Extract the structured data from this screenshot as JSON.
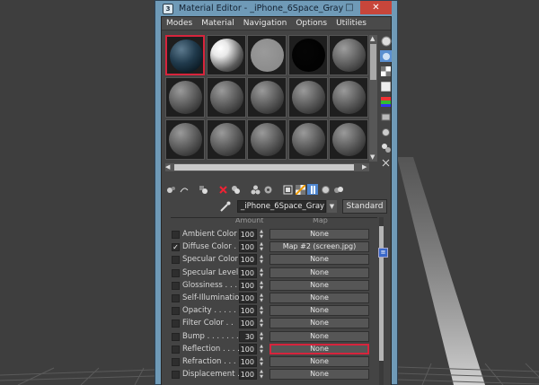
{
  "window": {
    "title": "Material Editor - _iPhone_6Space_Gray",
    "controls": {
      "minimize": "–",
      "maximize": "□",
      "close": "✕"
    }
  },
  "menu": [
    "Modes",
    "Material",
    "Navigation",
    "Options",
    "Utilities"
  ],
  "slots": {
    "rows": 3,
    "cols": 5,
    "active_index": 0,
    "colors": {
      "active_border": "#d7243c"
    }
  },
  "toolbar": {
    "icons": [
      "get-material-icon",
      "put-to-scene-icon",
      "assign-material-icon",
      "reset-icon",
      "make-copy-icon",
      "make-unique-icon",
      "put-to-library-icon",
      "material-id-icon",
      "show-map-icon",
      "show-shaded-icon",
      "show-end-result-icon",
      "go-to-parent-icon"
    ]
  },
  "material": {
    "name": "_iPhone_6Space_Gray",
    "type": "Standard"
  },
  "maps": {
    "header_amount": "Amount",
    "header_map": "Map",
    "rows": [
      {
        "label": "Ambient Color . .",
        "checked": false,
        "amount": "100",
        "map": "None"
      },
      {
        "label": "Diffuse Color . .",
        "checked": true,
        "amount": "100",
        "map": "Map #2 (screen.jpg)"
      },
      {
        "label": "Specular Color . .",
        "checked": false,
        "amount": "100",
        "map": "None"
      },
      {
        "label": "Specular Level .",
        "checked": false,
        "amount": "100",
        "map": "None"
      },
      {
        "label": "Glossiness . . . .",
        "checked": false,
        "amount": "100",
        "map": "None"
      },
      {
        "label": "Self-Illumination .",
        "checked": false,
        "amount": "100",
        "map": "None"
      },
      {
        "label": "Opacity . . . . .",
        "checked": false,
        "amount": "100",
        "map": "None"
      },
      {
        "label": "Filter Color . .",
        "checked": false,
        "amount": "100",
        "map": "None"
      },
      {
        "label": "Bump . . . . . . .",
        "checked": false,
        "amount": "30",
        "map": "None"
      },
      {
        "label": "Reflection . . . .",
        "checked": false,
        "amount": "100",
        "map": "None",
        "highlight": true
      },
      {
        "label": "Refraction . . . .",
        "checked": false,
        "amount": "100",
        "map": "None"
      },
      {
        "label": "Displacement . . .",
        "checked": false,
        "amount": "100",
        "map": "None"
      }
    ]
  }
}
